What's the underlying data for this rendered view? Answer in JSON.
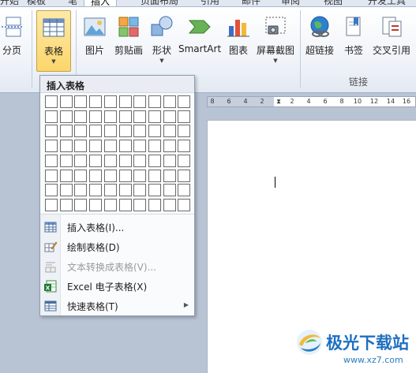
{
  "tabs": [
    {
      "label": "开始"
    },
    {
      "label": "模板"
    },
    {
      "label": "笔"
    },
    {
      "label": "插入",
      "active": true
    },
    {
      "label": "页面布局"
    },
    {
      "label": "引用"
    },
    {
      "label": "邮件"
    },
    {
      "label": "审阅"
    },
    {
      "label": "视图"
    },
    {
      "label": "开发工具"
    }
  ],
  "ribbon": {
    "page_break_label": "分页",
    "table_label": "表格",
    "picture_label": "图片",
    "clipart_label": "剪贴画",
    "shapes_label": "形状",
    "smartart_label": "SmartArt",
    "chart_label": "图表",
    "screenshot_label": "屏幕截图",
    "hyperlink_label": "超链接",
    "bookmark_label": "书签",
    "crossref_label": "交叉引用",
    "group_links_label": "链接"
  },
  "menu": {
    "header": "插入表格",
    "grid_cols": 10,
    "grid_rows": 8,
    "items": [
      {
        "label": "插入表格(I)...",
        "icon": "table-icon"
      },
      {
        "label": "绘制表格(D)",
        "icon": "pencil-table-icon"
      },
      {
        "label": "文本转换成表格(V)...",
        "icon": "text-to-table-icon",
        "disabled": true
      },
      {
        "label": "Excel 电子表格(X)",
        "icon": "excel-icon"
      },
      {
        "label": "快速表格(T)",
        "icon": "quick-table-icon",
        "submenu": true
      }
    ]
  },
  "ruler": {
    "labels": [
      "8",
      "6",
      "4",
      "2",
      "",
      "2",
      "4",
      "6",
      "8",
      "10",
      "12",
      "14",
      "16",
      "18"
    ]
  },
  "watermark": {
    "brand": "极光下载站",
    "url": "www.xz7.com"
  },
  "colors": {
    "accent": "#fbd66b",
    "ribbon_bg": "#eef2f8",
    "doc_bg": "#b8c4d4"
  }
}
